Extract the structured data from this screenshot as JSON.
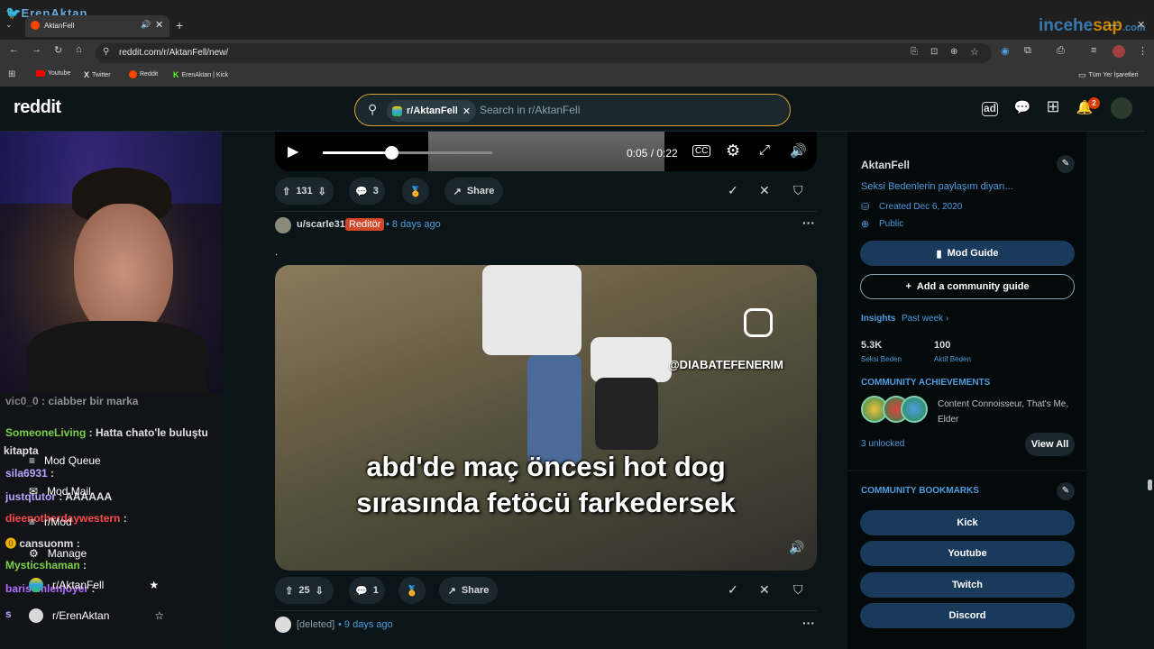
{
  "browser": {
    "tab_title": "AktanFell",
    "url": "reddit.com/r/AktanFell/new/",
    "watermark_left": "ErenAktan",
    "watermark_right_a": "incehe",
    "watermark_right_b": "sap",
    "watermark_right_c": ".com",
    "bookmarks": [
      "Youtube",
      "Twitter",
      "Reddit",
      "ErenAktan | Kick"
    ],
    "all_bookmarks": "Tüm Yer İşaretleri"
  },
  "reddit": {
    "logo": "reddit",
    "search_chip": "r/AktanFell",
    "search_placeholder": "Search in r/AktanFell",
    "notification_count": "2"
  },
  "post1": {
    "time": "0:05 / 0:22",
    "upvotes": "131",
    "comments": "3",
    "share": "Share"
  },
  "post2": {
    "author": "u/scarle31",
    "flair": "Reditör",
    "age": "• 8 days ago",
    "body": ".",
    "watermark": "@DIABATEFENERIM",
    "caption_line1": "abd'de maç öncesi hot dog",
    "caption_line2": "sırasında fetöcü farkedersek",
    "upvotes": "25",
    "comments": "1",
    "share": "Share"
  },
  "post3": {
    "author": "[deleted]",
    "age": "• 9 days ago"
  },
  "sidebar": {
    "name": "AktanFell",
    "description": "Seksi Bedenlerin paylaşım diyarı...",
    "created": "Created Dec 6, 2020",
    "visibility": "Public",
    "mod_guide": "Mod Guide",
    "add_guide": "Add a community guide",
    "insights": "Insights",
    "insights_period": "Past week ›",
    "stat1_value": "5.3K",
    "stat1_label": "Seksi Beden",
    "stat2_value": "100",
    "stat2_label": "Aktif Beden",
    "achievements_title": "COMMUNITY ACHIEVEMENTS",
    "achievements_text": "Content Connoisseur, That's Me, Elder",
    "unlocked": "3 unlocked",
    "view_all": "View All",
    "bookmarks_title": "COMMUNITY BOOKMARKS",
    "bookmark_links": [
      "Kick",
      "Youtube",
      "Twitch",
      "Discord"
    ]
  },
  "overlay": {
    "chat": [
      {
        "user": "vic0_0",
        "msg": " : ciabber bir marka",
        "color": "#e0e0e0"
      },
      {
        "user": "SomeoneLiving",
        "msg": " : Hatta chato'le buluştu",
        "color": "#7bd14a"
      },
      {
        "user": "",
        "msg": "kitapta",
        "color": "#e0e0e0"
      },
      {
        "user": "sila6931",
        "msg": " :",
        "color": "#b8a6ff"
      },
      {
        "user": "justqtutor",
        "msg": " : AAAAAA",
        "color": "#b8a6ff"
      },
      {
        "user": "dieenotherdaywestern",
        "msg": " :",
        "color": "#ff4a4a"
      },
      {
        "user": "cansuonm",
        "msg": " :",
        "color": "#e0e0e0"
      },
      {
        "user": "Mysticshaman",
        "msg": " :",
        "color": "#7bd14a"
      },
      {
        "user": "barisemlenjoyer",
        "msg": " :",
        "color": "#b06bff"
      },
      {
        "user": "s",
        "msg": "",
        "color": "#b8a6ff"
      }
    ],
    "nav": [
      "Mod Queue",
      "Mod Mail",
      "r/Mod",
      "Manage",
      "r/AktanFell",
      "r/ErenAktan"
    ]
  }
}
